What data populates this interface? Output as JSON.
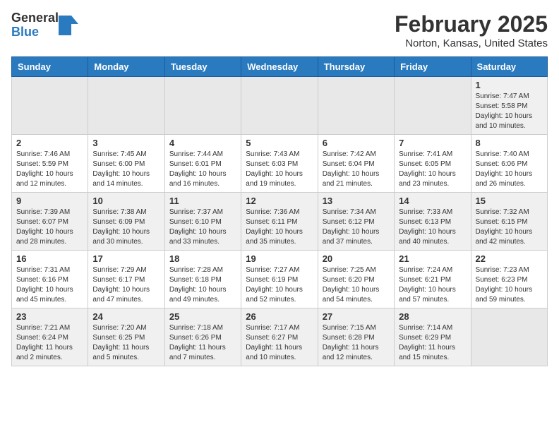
{
  "header": {
    "logo_general": "General",
    "logo_blue": "Blue",
    "title": "February 2025",
    "location": "Norton, Kansas, United States"
  },
  "days_of_week": [
    "Sunday",
    "Monday",
    "Tuesday",
    "Wednesday",
    "Thursday",
    "Friday",
    "Saturday"
  ],
  "weeks": [
    [
      {
        "day": "",
        "empty": true
      },
      {
        "day": "",
        "empty": true
      },
      {
        "day": "",
        "empty": true
      },
      {
        "day": "",
        "empty": true
      },
      {
        "day": "",
        "empty": true
      },
      {
        "day": "",
        "empty": true
      },
      {
        "day": "1",
        "info": "Sunrise: 7:47 AM\nSunset: 5:58 PM\nDaylight: 10 hours\nand 10 minutes."
      }
    ],
    [
      {
        "day": "2",
        "info": "Sunrise: 7:46 AM\nSunset: 5:59 PM\nDaylight: 10 hours\nand 12 minutes."
      },
      {
        "day": "3",
        "info": "Sunrise: 7:45 AM\nSunset: 6:00 PM\nDaylight: 10 hours\nand 14 minutes."
      },
      {
        "day": "4",
        "info": "Sunrise: 7:44 AM\nSunset: 6:01 PM\nDaylight: 10 hours\nand 16 minutes."
      },
      {
        "day": "5",
        "info": "Sunrise: 7:43 AM\nSunset: 6:03 PM\nDaylight: 10 hours\nand 19 minutes."
      },
      {
        "day": "6",
        "info": "Sunrise: 7:42 AM\nSunset: 6:04 PM\nDaylight: 10 hours\nand 21 minutes."
      },
      {
        "day": "7",
        "info": "Sunrise: 7:41 AM\nSunset: 6:05 PM\nDaylight: 10 hours\nand 23 minutes."
      },
      {
        "day": "8",
        "info": "Sunrise: 7:40 AM\nSunset: 6:06 PM\nDaylight: 10 hours\nand 26 minutes."
      }
    ],
    [
      {
        "day": "9",
        "info": "Sunrise: 7:39 AM\nSunset: 6:07 PM\nDaylight: 10 hours\nand 28 minutes."
      },
      {
        "day": "10",
        "info": "Sunrise: 7:38 AM\nSunset: 6:09 PM\nDaylight: 10 hours\nand 30 minutes."
      },
      {
        "day": "11",
        "info": "Sunrise: 7:37 AM\nSunset: 6:10 PM\nDaylight: 10 hours\nand 33 minutes."
      },
      {
        "day": "12",
        "info": "Sunrise: 7:36 AM\nSunset: 6:11 PM\nDaylight: 10 hours\nand 35 minutes."
      },
      {
        "day": "13",
        "info": "Sunrise: 7:34 AM\nSunset: 6:12 PM\nDaylight: 10 hours\nand 37 minutes."
      },
      {
        "day": "14",
        "info": "Sunrise: 7:33 AM\nSunset: 6:13 PM\nDaylight: 10 hours\nand 40 minutes."
      },
      {
        "day": "15",
        "info": "Sunrise: 7:32 AM\nSunset: 6:15 PM\nDaylight: 10 hours\nand 42 minutes."
      }
    ],
    [
      {
        "day": "16",
        "info": "Sunrise: 7:31 AM\nSunset: 6:16 PM\nDaylight: 10 hours\nand 45 minutes."
      },
      {
        "day": "17",
        "info": "Sunrise: 7:29 AM\nSunset: 6:17 PM\nDaylight: 10 hours\nand 47 minutes."
      },
      {
        "day": "18",
        "info": "Sunrise: 7:28 AM\nSunset: 6:18 PM\nDaylight: 10 hours\nand 49 minutes."
      },
      {
        "day": "19",
        "info": "Sunrise: 7:27 AM\nSunset: 6:19 PM\nDaylight: 10 hours\nand 52 minutes."
      },
      {
        "day": "20",
        "info": "Sunrise: 7:25 AM\nSunset: 6:20 PM\nDaylight: 10 hours\nand 54 minutes."
      },
      {
        "day": "21",
        "info": "Sunrise: 7:24 AM\nSunset: 6:21 PM\nDaylight: 10 hours\nand 57 minutes."
      },
      {
        "day": "22",
        "info": "Sunrise: 7:23 AM\nSunset: 6:23 PM\nDaylight: 10 hours\nand 59 minutes."
      }
    ],
    [
      {
        "day": "23",
        "info": "Sunrise: 7:21 AM\nSunset: 6:24 PM\nDaylight: 11 hours\nand 2 minutes."
      },
      {
        "day": "24",
        "info": "Sunrise: 7:20 AM\nSunset: 6:25 PM\nDaylight: 11 hours\nand 5 minutes."
      },
      {
        "day": "25",
        "info": "Sunrise: 7:18 AM\nSunset: 6:26 PM\nDaylight: 11 hours\nand 7 minutes."
      },
      {
        "day": "26",
        "info": "Sunrise: 7:17 AM\nSunset: 6:27 PM\nDaylight: 11 hours\nand 10 minutes."
      },
      {
        "day": "27",
        "info": "Sunrise: 7:15 AM\nSunset: 6:28 PM\nDaylight: 11 hours\nand 12 minutes."
      },
      {
        "day": "28",
        "info": "Sunrise: 7:14 AM\nSunset: 6:29 PM\nDaylight: 11 hours\nand 15 minutes."
      },
      {
        "day": "",
        "empty": true
      }
    ]
  ]
}
